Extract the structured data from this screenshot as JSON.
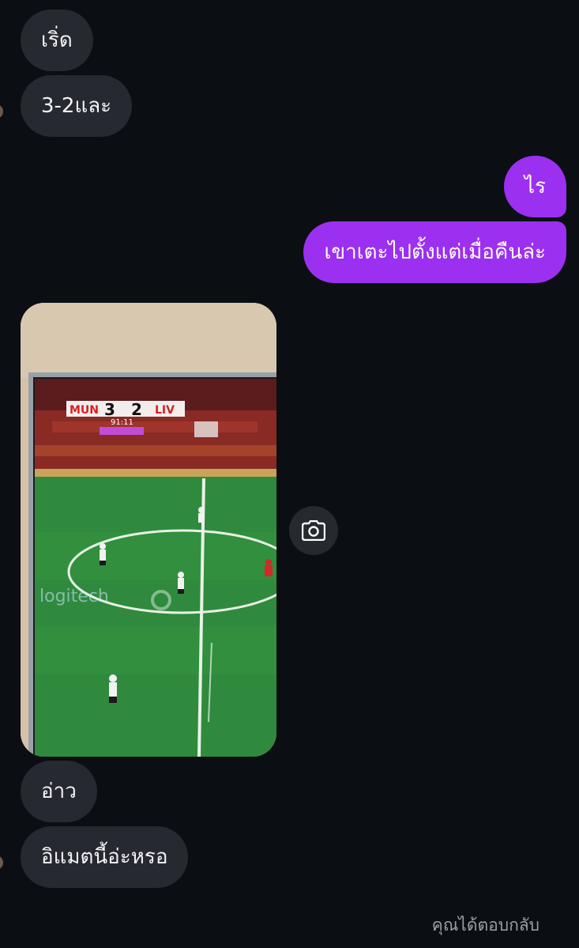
{
  "conversation": {
    "messages": [
      {
        "sender": "them",
        "text": "เริ่ด"
      },
      {
        "sender": "them",
        "text": "3-2และ"
      },
      {
        "sender": "me",
        "text": "ไร"
      },
      {
        "sender": "me",
        "text": "เขาเตะไปตั้งแต่เมื่อคืนล่ะ"
      },
      {
        "sender": "them",
        "type": "photo",
        "scoreboard": {
          "home": "MUN",
          "home_score": "3",
          "away_score": "2",
          "away": "LIV",
          "clock": "91:11"
        },
        "sponsor_text": "logitech"
      },
      {
        "sender": "them",
        "text": "อ่าว"
      },
      {
        "sender": "them",
        "text": "อิแมตนี้อ่ะหรอ"
      }
    ],
    "status": "คุณได้ตอบกลับ"
  },
  "icons": {
    "photo_action": "camera-icon"
  },
  "colors": {
    "background": "#0b0f14",
    "incoming_bubble": "#262a30",
    "outgoing_bubble": "#9b30f0",
    "status_text": "#9aa0a8"
  }
}
